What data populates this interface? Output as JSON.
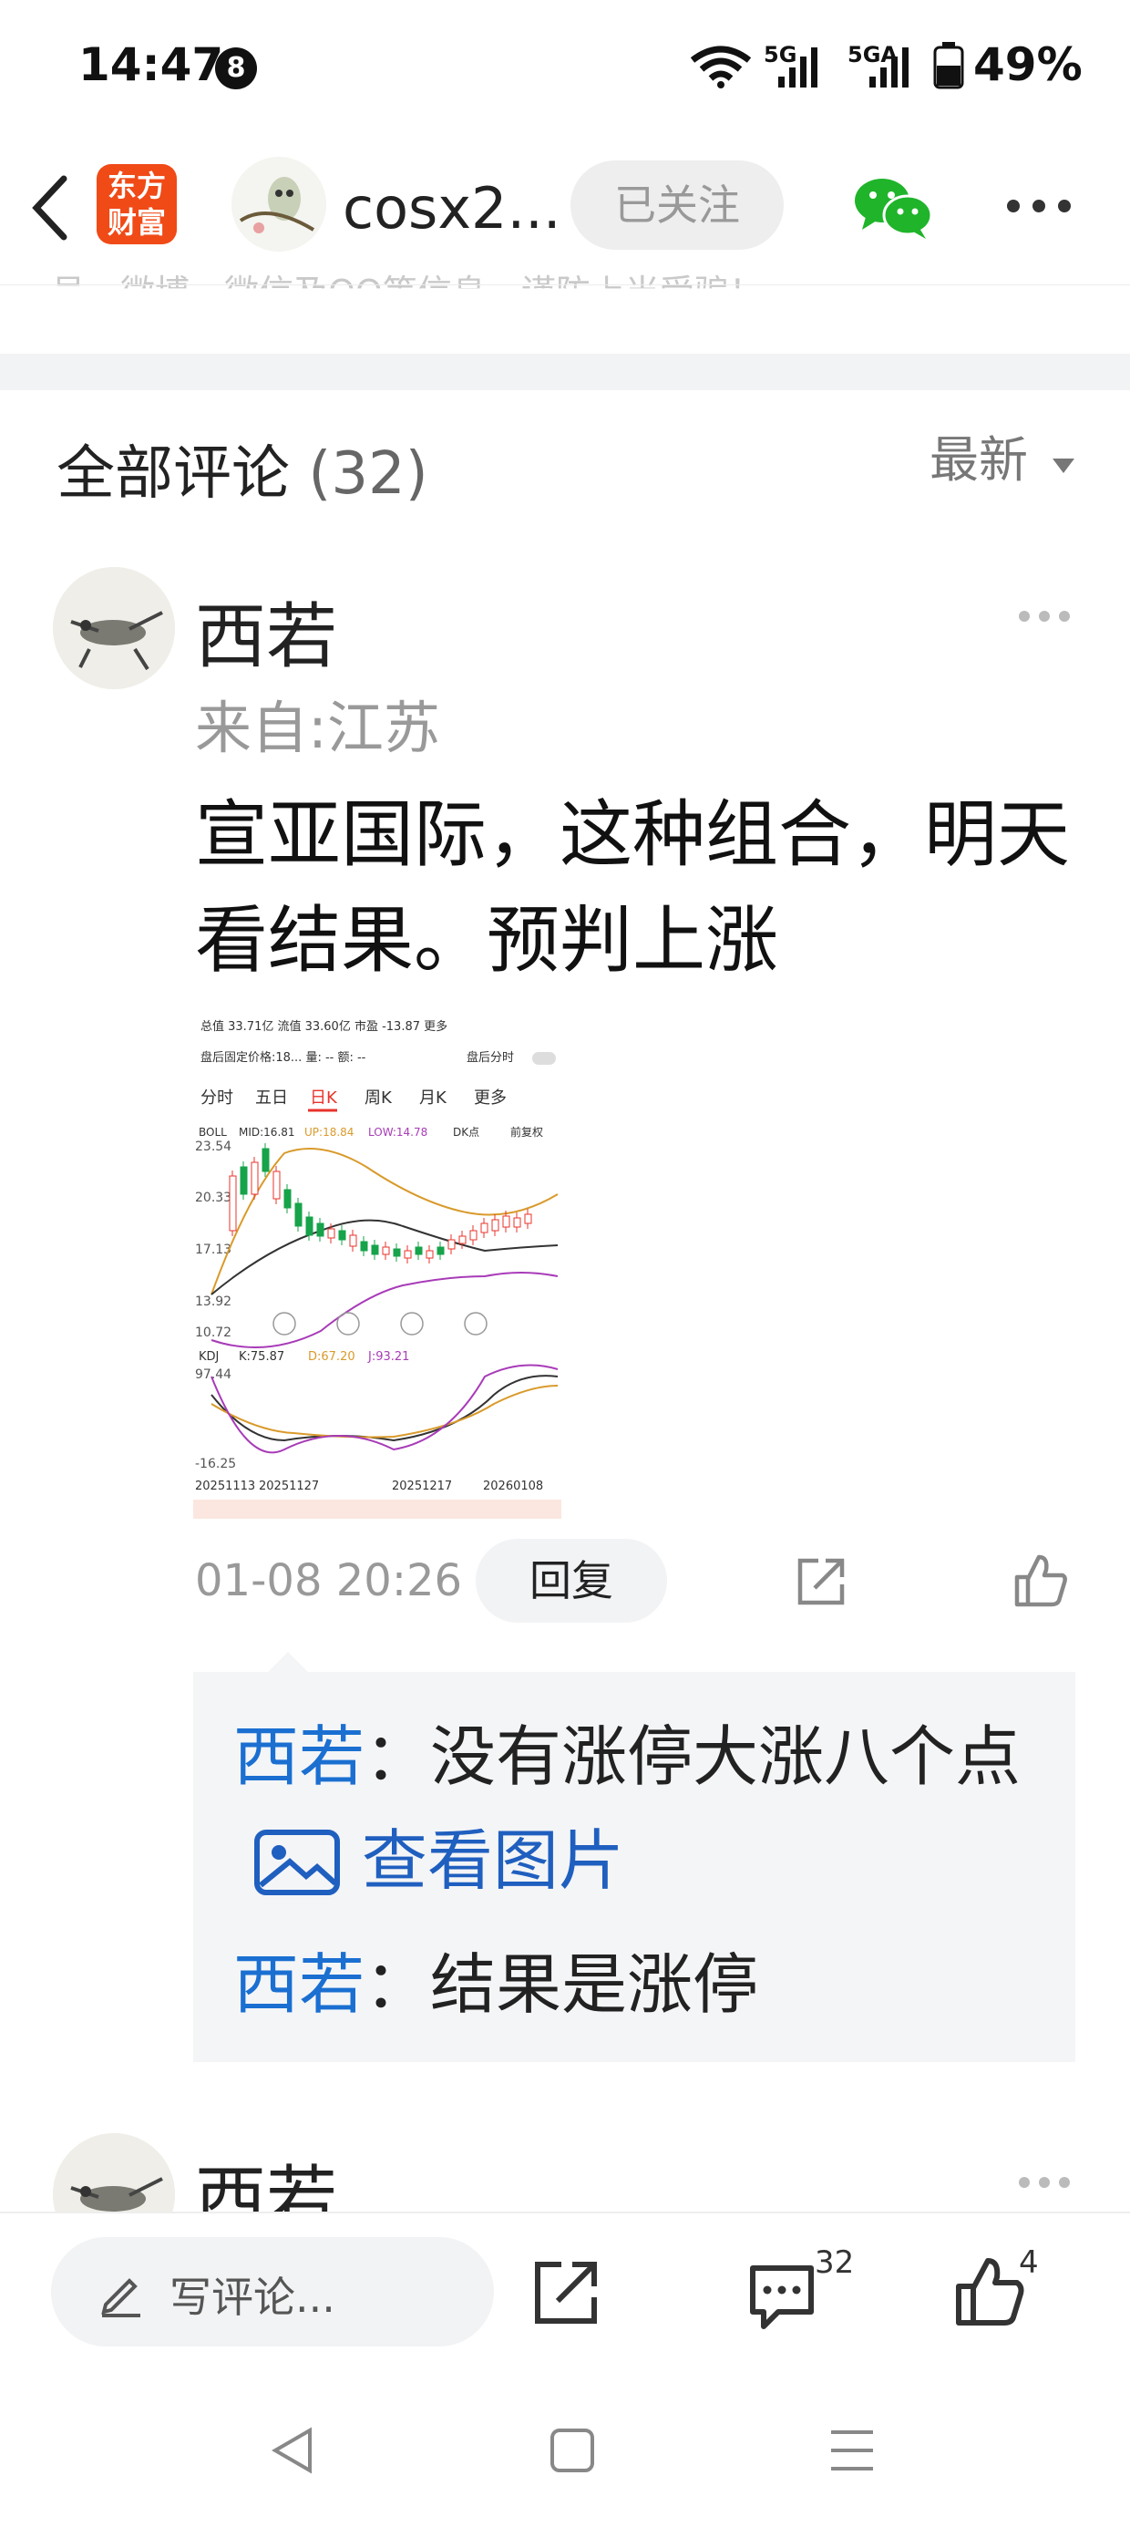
{
  "status_bar": {
    "time": "14:47",
    "badge": "8",
    "network": "5G",
    "network2": "5GA",
    "battery": "49%"
  },
  "header": {
    "logo_text_line1": "东方",
    "logo_text_line2": "财富",
    "title": "cosx2...",
    "follow_label": "已关注"
  },
  "notice_truncated": "号、微博、微信及QQ等信息，谨防上当受骗！",
  "comments": {
    "title": "全部评论",
    "count": "(32)",
    "sort_label": "最新"
  },
  "comment1": {
    "user": "西若",
    "location": "来自:江苏",
    "text": "宣亚国际，这种组合，明天看结果。预判上涨",
    "timestamp": "01-08 20:26",
    "reply_label": "回复",
    "replies": [
      {
        "user": "西若",
        "sep": "：",
        "text": "没有涨停大涨八个点",
        "image_link": "查看图片"
      },
      {
        "user": "西若",
        "sep": "：",
        "text": "结果是涨停"
      }
    ]
  },
  "comment2": {
    "user": "西若"
  },
  "stock_screenshot": {
    "top_row": [
      "总值",
      "33.71亿",
      "流值",
      "33.60亿",
      "市盈",
      "-13.87",
      "更多"
    ],
    "fixed_price_label": "盘后固定价格:",
    "fixed_price_value": "18...",
    "volume_label": "量: --",
    "amount_label": "额: --",
    "after_hours_label": "盘后分时",
    "tabs": [
      "分时",
      "五日",
      "日K",
      "周K",
      "月K",
      "更多"
    ],
    "boll_label": "BOLL",
    "boll_mid": "MID:16.81",
    "boll_up": "UP:18.84",
    "boll_low": "LOW:14.78",
    "dk_label": "DK点",
    "adjust_label": "前复权",
    "y_ticks": [
      "23.54",
      "20.33",
      "17.13",
      "13.92",
      "10.72"
    ],
    "kdj_label": "KDJ",
    "kdj_k": "K:75.87",
    "kdj_d": "D:67.20",
    "kdj_j": "J:93.21",
    "kdj_ticks": [
      "97.44",
      "-16.25"
    ],
    "dates": [
      "20251113",
      "20251127",
      "20251217",
      "20260108"
    ],
    "colors": {
      "up": "#e8332b",
      "down": "#16a34a",
      "boll_up": "#d99a2b",
      "boll_low": "#a83bb8",
      "mid": "#333333"
    }
  },
  "bottom_bar": {
    "write_label": "写评论...",
    "comment_count": "32",
    "like_count": "4"
  },
  "colors": {
    "accent_blue": "#1a6fd1",
    "brand_orange": "#f04a17",
    "wechat_green": "#1fb42a"
  }
}
